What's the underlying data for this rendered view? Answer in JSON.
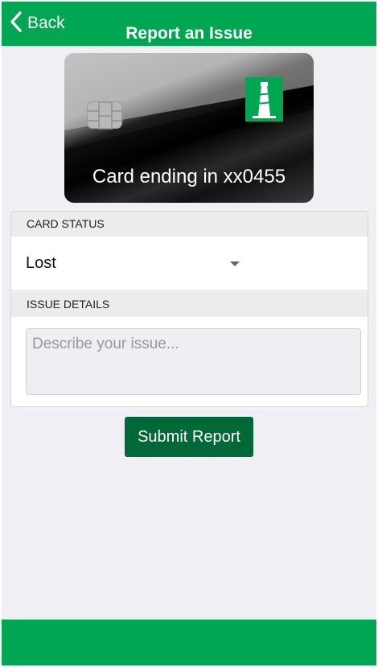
{
  "header": {
    "back_label": "Back",
    "title": "Report an Issue"
  },
  "card": {
    "caption": "Card ending in xx0455"
  },
  "form": {
    "card_status_heading": "CARD STATUS",
    "card_status_value": "Lost",
    "issue_details_heading": "ISSUE DETAILS",
    "issue_details_placeholder": "Describe your issue..."
  },
  "actions": {
    "submit_label": "Submit Report"
  },
  "colors": {
    "brand_green": "#00a651",
    "button_green": "#006937",
    "background": "#efeff4"
  },
  "icons": {
    "back": "chevron-left-icon",
    "dropdown": "caret-down-icon",
    "card_chip": "chip-icon",
    "bank_logo": "lighthouse-logo"
  }
}
